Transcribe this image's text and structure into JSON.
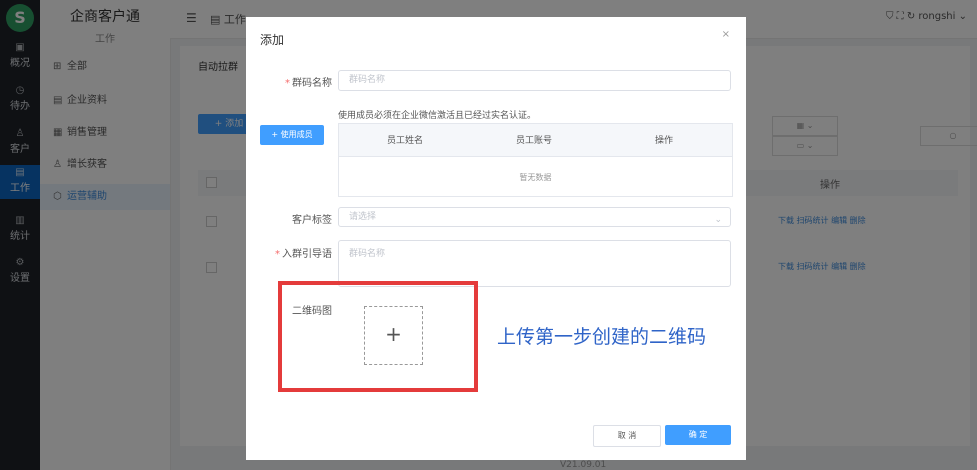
{
  "sidebar": {
    "items": [
      {
        "label": "概况",
        "icon": "chart-icon"
      },
      {
        "label": "待办",
        "icon": "clock-icon"
      },
      {
        "label": "客户",
        "icon": "user-icon"
      },
      {
        "label": "工作",
        "icon": "briefcase-icon"
      },
      {
        "label": "统计",
        "icon": "bar-chart-icon"
      },
      {
        "label": "设置",
        "icon": "gear-icon"
      }
    ]
  },
  "subnav": {
    "brand": "企商客户通",
    "brand_sub": "工作",
    "items": [
      {
        "label": "全部",
        "icon": "grid-icon"
      },
      {
        "label": "企业资料",
        "icon": "document-icon"
      },
      {
        "label": "销售管理",
        "icon": "folder-icon"
      },
      {
        "label": "增长获客",
        "icon": "user-plus-icon"
      },
      {
        "label": "运营辅助",
        "icon": "shield-icon"
      }
    ]
  },
  "header": {
    "tab": "工作",
    "username": "rongshi"
  },
  "content": {
    "tab": "自动拉群",
    "add_label": "+ 添加",
    "op_header": "操作",
    "row_ops": "下载  扫码统计  编辑  删除",
    "version": "V21.09.01"
  },
  "modal": {
    "title": "添加",
    "close": "×",
    "group_code_label": "群码名称",
    "group_code_placeholder": "群码名称",
    "hint": "使用成员必须在企业微信激活且已经过实名认证。",
    "use_member_button": "+ 使用成员",
    "table_headers": [
      "员工姓名",
      "员工账号",
      "操作"
    ],
    "table_empty": "暂无数据",
    "tag_label": "客户标签",
    "tag_placeholder": "请选择",
    "guide_label": "入群引导语",
    "guide_placeholder": "群码名称",
    "qr_label": "二维码图",
    "upload_plus": "+",
    "cancel_button": "取 消",
    "ok_button": "确 定"
  },
  "annotation": {
    "text": "上传第一步创建的二维码",
    "color": "#2f64c8",
    "box_color": "#e43b3b"
  }
}
